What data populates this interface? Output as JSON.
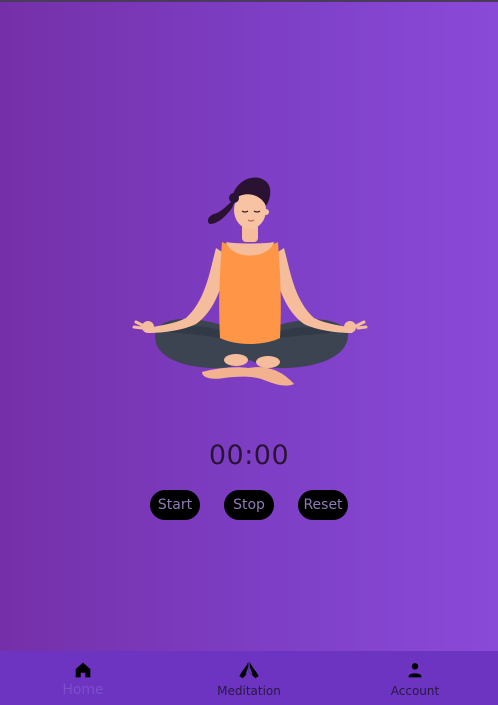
{
  "timer": {
    "display": "00:00"
  },
  "controls": {
    "start_label": "Start",
    "stop_label": "Stop",
    "reset_label": "Reset"
  },
  "nav": {
    "items": [
      {
        "label": "Home",
        "icon": "home-icon",
        "active": true
      },
      {
        "label": "Meditation",
        "icon": "praying-hands-icon",
        "active": false
      },
      {
        "label": "Account",
        "icon": "person-icon",
        "active": false
      }
    ]
  },
  "colors": {
    "background_start": "#7530a8",
    "background_end": "#8a4ad8",
    "nav_bar": "#6c34c0",
    "button_bg": "#000000",
    "button_text": "#8e7bb5",
    "timer_text": "#2a1436",
    "active_nav_label": "#7d4fca"
  }
}
